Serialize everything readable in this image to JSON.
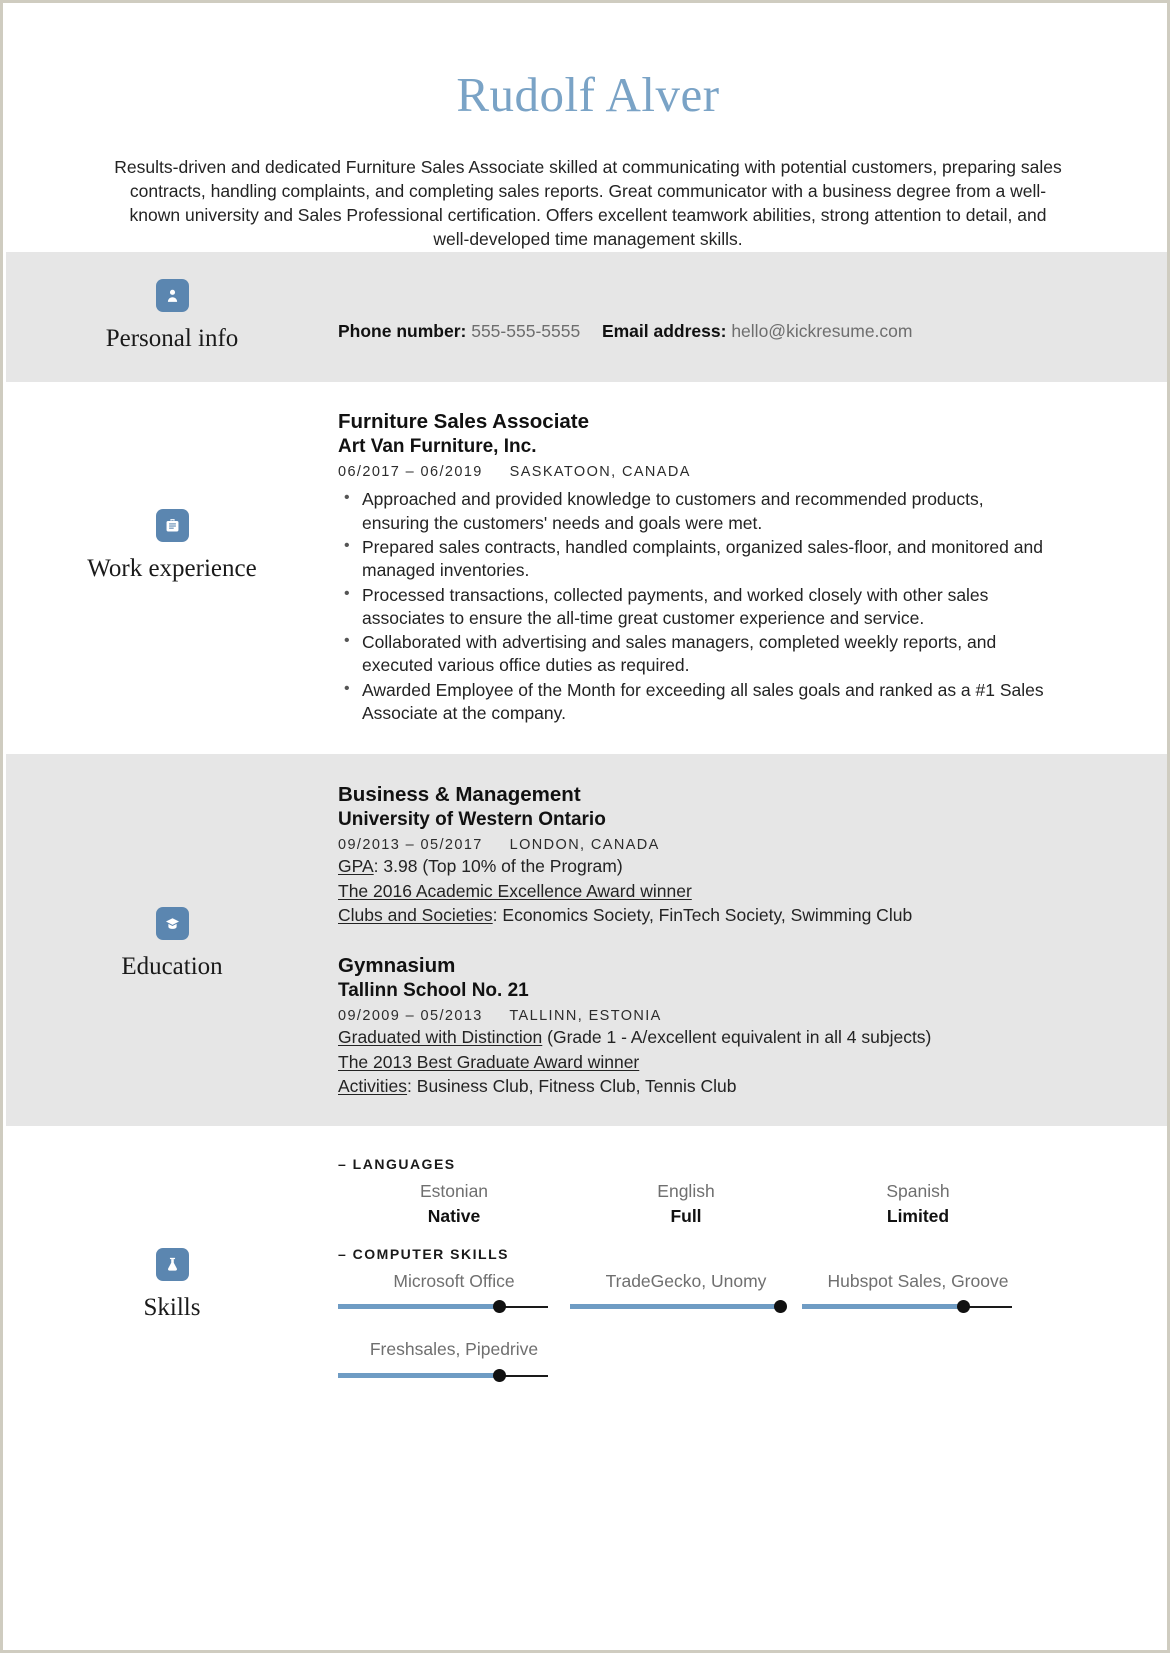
{
  "header": {
    "name": "Rudolf Alver",
    "summary": "Results-driven and dedicated Furniture Sales Associate skilled at communicating with potential customers, preparing sales contracts, handling complaints, and completing sales reports. Great communicator with a business degree from a well-known university and Sales Professional certification. Offers excellent teamwork abilities, strong attention to detail, and well-developed time management skills."
  },
  "personal_info": {
    "section_title": "Personal info",
    "icon": "person-icon",
    "phone_label": "Phone number:",
    "phone_value": "555-555-5555",
    "email_label": "Email address:",
    "email_value": "hello@kickresume.com"
  },
  "work_experience": {
    "section_title": "Work experience",
    "icon": "briefcase-icon",
    "entries": [
      {
        "title": "Furniture Sales Associate",
        "company": "Art Van Furniture, Inc.",
        "dates": "06/2017 – 06/2019",
        "location": "SASKATOON, CANADA",
        "bullets": [
          "Approached and provided knowledge to customers and recommended products, ensuring the customers' needs and goals were met.",
          "Prepared sales contracts, handled complaints, organized sales-floor, and monitored and managed inventories.",
          "Processed transactions, collected payments, and worked closely with other sales associates to ensure the all-time great customer experience and service.",
          "Collaborated with advertising and sales managers, completed weekly reports, and executed various office duties as required.",
          "Awarded Employee of the Month for exceeding all sales goals and ranked as a #1 Sales Associate at the company."
        ]
      }
    ]
  },
  "education": {
    "section_title": "Education",
    "icon": "graduation-cap-icon",
    "entries": [
      {
        "title": "Business & Management",
        "school": "University of Western Ontario",
        "dates": "09/2013 – 05/2017",
        "location": "LONDON, CANADA",
        "details": [
          {
            "label": "GPA",
            "label_underlined": true,
            "separator": ": ",
            "text": "3.98 (Top 10% of the Program)"
          },
          {
            "label": "The 2016 Academic Excellence Award winner",
            "label_underlined": true,
            "separator": "",
            "text": ""
          },
          {
            "label": "Clubs and Societies",
            "label_underlined": true,
            "separator": ": ",
            "text": "Economics Society, FinTech Society, Swimming Club"
          }
        ]
      },
      {
        "title": "Gymnasium",
        "school": "Tallinn School No. 21",
        "dates": "09/2009 – 05/2013",
        "location": "TALLINN, ESTONIA",
        "details": [
          {
            "label": "Graduated with Distinction",
            "label_underlined": true,
            "separator": " ",
            "text": "(Grade 1 - A/excellent equivalent in all 4 subjects)"
          },
          {
            "label": "The 2013 Best Graduate Award winner",
            "label_underlined": true,
            "separator": "",
            "text": ""
          },
          {
            "label": "Activities",
            "label_underlined": true,
            "separator": ": ",
            "text": "Business Club, Fitness Club, Tennis Club"
          }
        ]
      }
    ]
  },
  "skills": {
    "section_title": "Skills",
    "icon": "flask-icon",
    "languages_head": "– LANGUAGES",
    "languages": [
      {
        "name": "Estonian",
        "level": "Native"
      },
      {
        "name": "English",
        "level": "Full"
      },
      {
        "name": "Spanish",
        "level": "Limited"
      }
    ],
    "computer_head": "– COMPUTER SKILLS",
    "computer_skills": [
      {
        "name": "Microsoft Office",
        "percent": 77
      },
      {
        "name": "TradeGecko, Unomy",
        "percent": 100
      },
      {
        "name": "Hubspot Sales, Groove",
        "percent": 77
      },
      {
        "name": "Freshsales, Pipedrive",
        "percent": 77
      }
    ]
  },
  "colors": {
    "accent_blue": "#7aa3c6",
    "icon_blue": "#5b86b0",
    "band_gray": "#e6e6e6",
    "slider_blue": "#6f9cc4"
  }
}
